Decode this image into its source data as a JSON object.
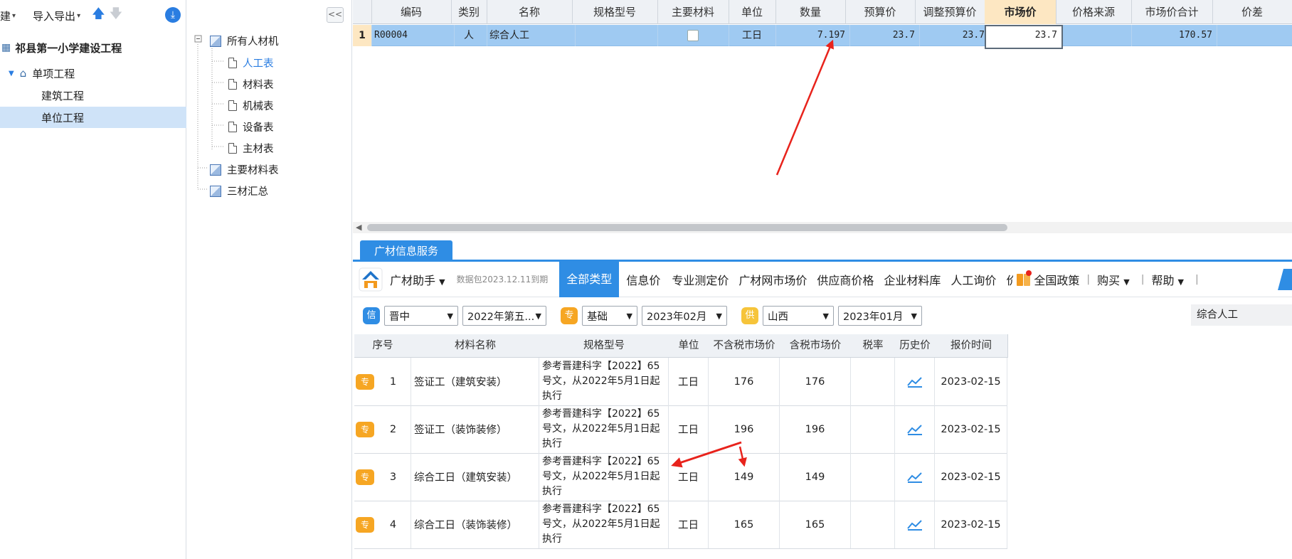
{
  "left_panel": {
    "toolbar": {
      "new_label": "建",
      "import_export_label": "导入导出"
    },
    "tree": [
      {
        "label": "祁县第一小学建设工程",
        "level": 0,
        "icon": "building-icon",
        "selected": false
      },
      {
        "label": "单项工程",
        "level": 1,
        "icon": "home-icon",
        "selected": false
      },
      {
        "label": "建筑工程",
        "level": 2,
        "icon": "",
        "selected": false
      },
      {
        "label": "单位工程",
        "level": 2,
        "icon": "",
        "selected": true
      }
    ]
  },
  "mid_panel": {
    "collapse_label": "<<",
    "root": "所有人材机",
    "children": [
      "人工表",
      "材料表",
      "机械表",
      "设备表",
      "主材表"
    ],
    "others": [
      "主要材料表",
      "三材汇总"
    ]
  },
  "main_grid": {
    "columns": [
      "编码",
      "类别",
      "名称",
      "规格型号",
      "主要材料",
      "单位",
      "数量",
      "预算价",
      "调整预算价",
      "市场价",
      "价格来源",
      "市场价合计",
      "价差"
    ],
    "rows": [
      {
        "index": "1",
        "code": "R00004",
        "category": "人",
        "name": "综合人工",
        "spec": "",
        "main_material": false,
        "unit": "工日",
        "quantity": "7.197",
        "budget_price": "23.7",
        "adjusted_budget_price": "23.7",
        "market_price": "23.7",
        "price_source": "",
        "market_total": "170.57",
        "price_diff": ""
      }
    ]
  },
  "info_panel": {
    "tab_label": "广材信息服务",
    "assistant_label": "广材助手",
    "data_pkg_label": "数据包2023.12.11到期",
    "type_tabs": [
      "全部类型",
      "信息价",
      "专业测定价",
      "广材网市场价",
      "供应商价格",
      "企业材料库",
      "人工询价",
      "价"
    ],
    "policy_label": "全国政策",
    "buy_label": "购买",
    "help_label": "帮助",
    "filters": {
      "xin_badge": "信",
      "region": "晋中",
      "period": "2022年第五...",
      "zhuan_badge": "专",
      "base": "基础",
      "zhuan_month": "2023年02月",
      "gong_badge": "供",
      "province": "山西",
      "gong_month": "2023年01月",
      "search_value": "综合人工"
    },
    "table_columns": [
      "序号",
      "材料名称",
      "规格型号",
      "单位",
      "不含税市场价",
      "含税市场价",
      "税率",
      "历史价",
      "报价时间"
    ],
    "rows": [
      {
        "badge": "专",
        "index": "1",
        "name": "签证工（建筑安装）",
        "spec": "参考晋建科字【2022】65号文，从2022年5月1日起执行",
        "unit": "工日",
        "price_ex_tax": "176",
        "price_inc_tax": "176",
        "tax_rate": "",
        "date": "2023-02-15"
      },
      {
        "badge": "专",
        "index": "2",
        "name": "签证工（装饰装修）",
        "spec": "参考晋建科字【2022】65号文，从2022年5月1日起执行",
        "unit": "工日",
        "price_ex_tax": "196",
        "price_inc_tax": "196",
        "tax_rate": "",
        "date": "2023-02-15"
      },
      {
        "badge": "专",
        "index": "3",
        "name": "综合工日（建筑安装）",
        "spec": "参考晋建科字【2022】65号文，从2022年5月1日起执行",
        "unit": "工日",
        "price_ex_tax": "149",
        "price_inc_tax": "149",
        "tax_rate": "",
        "date": "2023-02-15"
      },
      {
        "badge": "专",
        "index": "4",
        "name": "综合工日（装饰装修）",
        "spec": "参考晋建科字【2022】65号文，从2022年5月1日起执行",
        "unit": "工日",
        "price_ex_tax": "165",
        "price_inc_tax": "165",
        "tax_rate": "",
        "date": "2023-02-15"
      }
    ]
  },
  "colors": {
    "accent": "#2f8de4",
    "selected_row": "#9fcaf2",
    "highlight_header": "#fde7c2",
    "badge_orange": "#f6a623",
    "annotation_red": "#e8231c"
  }
}
